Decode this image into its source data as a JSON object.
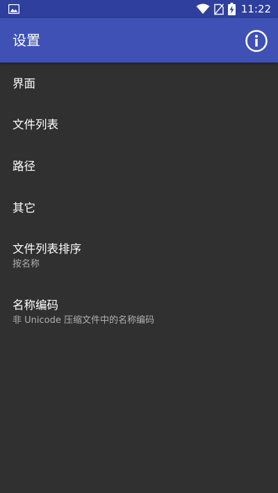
{
  "status_bar": {
    "time": "11:22",
    "icons": [
      "image-notification-icon",
      "wifi-icon",
      "no-sim-icon",
      "battery-charging-icon"
    ]
  },
  "app_bar": {
    "title": "设置",
    "info_icon": "info-icon"
  },
  "colors": {
    "status_bar": "#2f3f9d",
    "app_bar": "#3f51b5",
    "background": "#303030",
    "text_primary": "#ffffff",
    "text_secondary": "#b0b0b0"
  },
  "settings": [
    {
      "title": "界面"
    },
    {
      "title": "文件列表"
    },
    {
      "title": "路径"
    },
    {
      "title": "其它"
    },
    {
      "title": "文件列表排序",
      "summary": "按名称"
    },
    {
      "title": "名称编码",
      "summary": "非 Unicode 压缩文件中的名称编码"
    }
  ]
}
